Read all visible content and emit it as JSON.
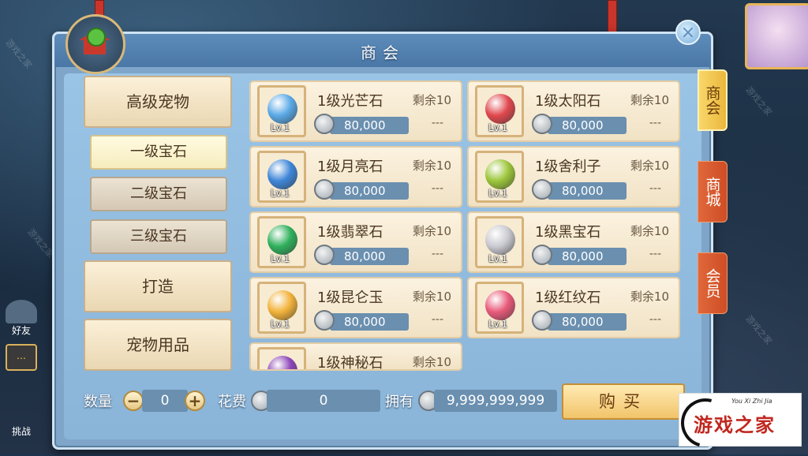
{
  "dialog": {
    "title": "商会",
    "close_icon": "close-icon"
  },
  "menu": {
    "items": [
      {
        "label": "高级宠物",
        "kind": "category"
      },
      {
        "label": "一级宝石",
        "kind": "sub",
        "active": true
      },
      {
        "label": "二级宝石",
        "kind": "sub"
      },
      {
        "label": "三级宝石",
        "kind": "sub"
      },
      {
        "label": "打造",
        "kind": "category"
      },
      {
        "label": "宠物用品",
        "kind": "category"
      }
    ]
  },
  "items": [
    {
      "name": "1级光芒石",
      "remain": "剩余10",
      "price": "80,000",
      "level": "Lv.1",
      "dash": "---",
      "gem_color": "#5aa9e6"
    },
    {
      "name": "1级太阳石",
      "remain": "剩余10",
      "price": "80,000",
      "level": "Lv.1",
      "dash": "---",
      "gem_color": "#e0484e"
    },
    {
      "name": "1级月亮石",
      "remain": "剩余10",
      "price": "80,000",
      "level": "Lv.1",
      "dash": "---",
      "gem_color": "#3f86d8"
    },
    {
      "name": "1级舍利子",
      "remain": "剩余10",
      "price": "80,000",
      "level": "Lv.1",
      "dash": "---",
      "gem_color": "#9cc63a"
    },
    {
      "name": "1级翡翠石",
      "remain": "剩余10",
      "price": "80,000",
      "level": "Lv.1",
      "dash": "---",
      "gem_color": "#2fb05c"
    },
    {
      "name": "1级黑宝石",
      "remain": "剩余10",
      "price": "80,000",
      "level": "Lv.1",
      "dash": "---",
      "gem_color": "#c9c9d0"
    },
    {
      "name": "1级昆仑玉",
      "remain": "剩余10",
      "price": "80,000",
      "level": "Lv.1",
      "dash": "---",
      "gem_color": "#f2b23a"
    },
    {
      "name": "1级红纹石",
      "remain": "剩余10",
      "price": "80,000",
      "level": "Lv.1",
      "dash": "---",
      "gem_color": "#e85a7a"
    },
    {
      "name": "1级神秘石",
      "remain": "剩余10",
      "price": "",
      "level": "",
      "dash": "",
      "gem_color": "#8d45b8"
    }
  ],
  "footer": {
    "quantity_label": "数量",
    "quantity_value": "0",
    "minus": "−",
    "plus": "+",
    "cost_label": "花费",
    "cost_value": "0",
    "own_label": "拥有",
    "own_value": "9,999,999,999",
    "buy_label": "购买"
  },
  "right_tabs": [
    {
      "label": "商会",
      "active": true
    },
    {
      "label": "商城",
      "active": false
    },
    {
      "label": "会员",
      "active": false
    }
  ],
  "hud": {
    "left_labels": [
      "好友",
      "挑战"
    ]
  },
  "watermark": {
    "logo_text": "游戏之家",
    "logo_sub": "You Xi Zhi Jia",
    "diagonal": "游戏之家"
  }
}
